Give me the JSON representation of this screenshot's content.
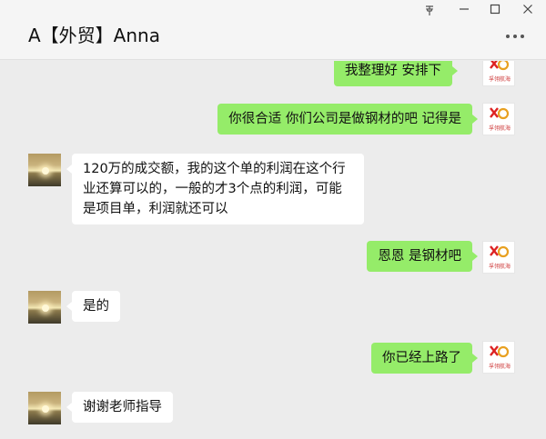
{
  "window": {
    "title": "A【外贸】Anna",
    "pin_icon": "pin-icon",
    "minimize_icon": "minimize-icon",
    "maximize_icon": "maximize-icon",
    "close_icon": "close-icon",
    "more_icon": "more-icon"
  },
  "colors": {
    "my_bubble": "#95ec69",
    "their_bubble": "#ffffff",
    "background": "#ececec"
  },
  "me": {
    "logo_text": "孚翎航海"
  },
  "messages": [
    {
      "sender": "me",
      "text": "我整理好 安排下"
    },
    {
      "sender": "me",
      "text": "你很合适 你们公司是做钢材的吧 记得是"
    },
    {
      "sender": "other",
      "text": "120万的成交额，我的这个单的利润在这个行业还算可以的，一般的才3个点的利润，可能是项目单，利润就还可以"
    },
    {
      "sender": "me",
      "text": "恩恩 是钢材吧"
    },
    {
      "sender": "other",
      "text": "是的"
    },
    {
      "sender": "me",
      "text": "你已经上路了"
    },
    {
      "sender": "other",
      "text": "谢谢老师指导"
    }
  ]
}
